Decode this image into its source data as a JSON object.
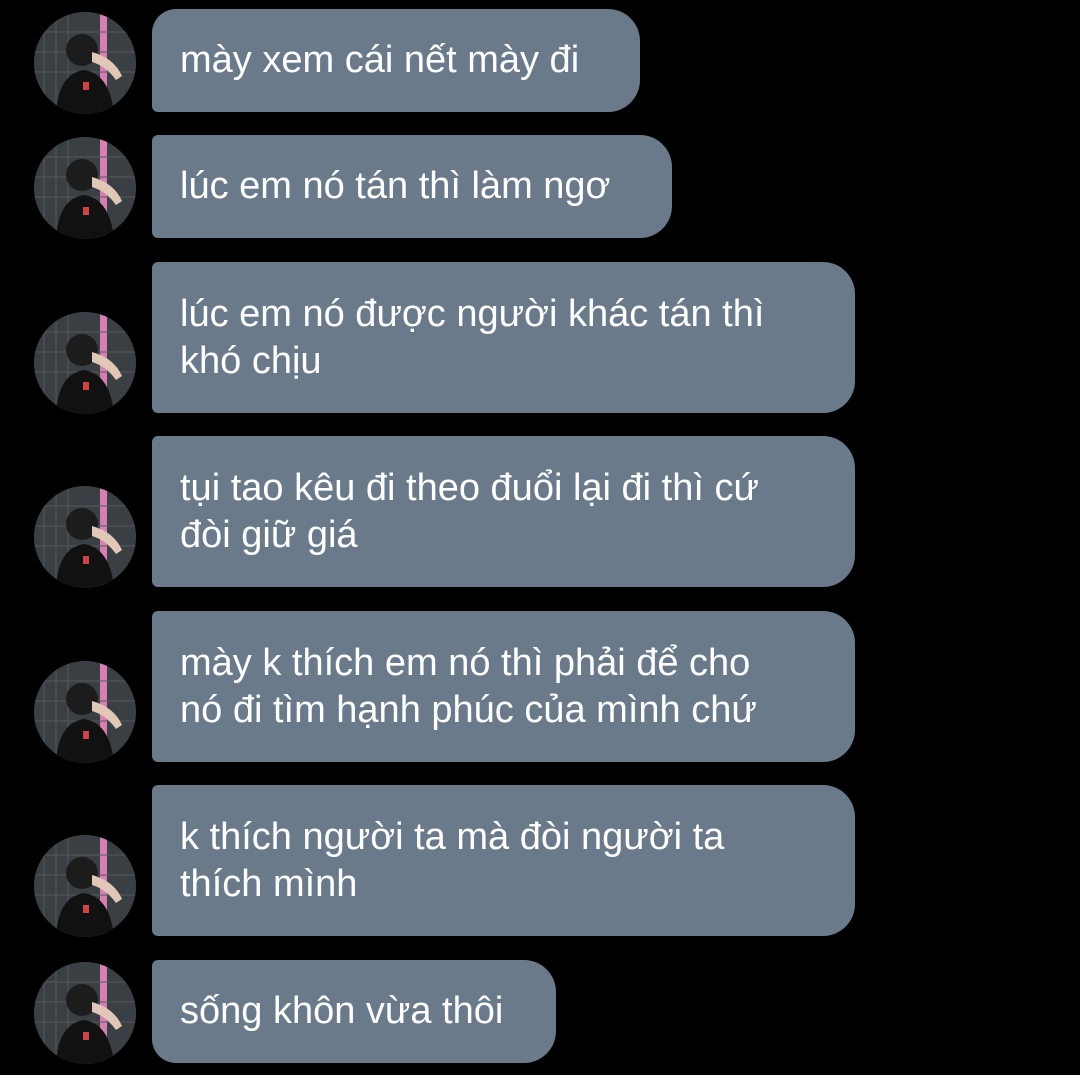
{
  "app": {
    "background_color": "#000000",
    "bubble_color": "#6b7a8a",
    "text_color": "#ffffff",
    "avatar_icon": "profile-photo"
  },
  "messages": [
    {
      "lines": [
        "mày xem cái nết mày đi"
      ]
    },
    {
      "lines": [
        "lúc em nó tán thì làm ngơ"
      ]
    },
    {
      "lines": [
        "lúc em nó được người khác tán thì",
        "khó chịu"
      ]
    },
    {
      "lines": [
        "tụi tao kêu đi theo đuổi lại đi thì cứ",
        "đòi giữ giá"
      ]
    },
    {
      "lines": [
        "mày k thích em nó thì phải để cho",
        "nó đi tìm hạnh phúc của mình chứ"
      ]
    },
    {
      "lines": [
        "k thích người ta mà đòi người ta",
        "thích mình"
      ]
    },
    {
      "lines": [
        "sống khôn vừa thôi"
      ]
    }
  ]
}
